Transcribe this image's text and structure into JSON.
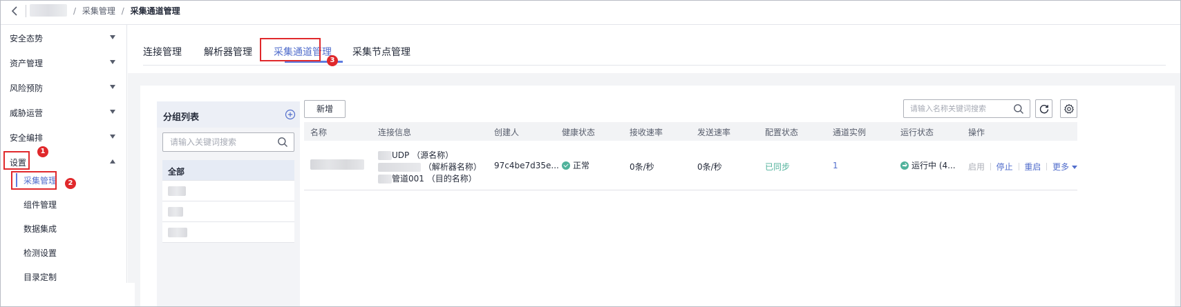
{
  "breadcrumb": {
    "items": [
      "采集管理",
      "采集通道管理"
    ],
    "separator": "/"
  },
  "sidebar": {
    "items": [
      {
        "label": "安全态势"
      },
      {
        "label": "资产管理"
      },
      {
        "label": "风险预防"
      },
      {
        "label": "威胁运营"
      },
      {
        "label": "安全编排"
      },
      {
        "label": "设置"
      }
    ],
    "sub_items": [
      {
        "label": "采集管理"
      },
      {
        "label": "组件管理"
      },
      {
        "label": "数据集成"
      },
      {
        "label": "检测设置"
      },
      {
        "label": "目录定制"
      }
    ],
    "active_sub": "采集管理"
  },
  "annotations": {
    "badge1": "1",
    "badge2": "2",
    "badge3": "3",
    "color": "#e0282b"
  },
  "tabs": [
    {
      "label": "连接管理"
    },
    {
      "label": "解析器管理"
    },
    {
      "label": "采集通道管理"
    },
    {
      "label": "采集节点管理"
    }
  ],
  "active_tab": "采集通道管理",
  "group_panel": {
    "title": "分组列表",
    "search_placeholder": "请输入关键词搜索",
    "all_label": "全部"
  },
  "toolbar": {
    "new_label": "新增",
    "search_placeholder": "请输入名称关键词搜索",
    "refresh_icon": "refresh-icon",
    "settings_icon": "gear-icon"
  },
  "table": {
    "columns": [
      "名称",
      "连接信息",
      "创建人",
      "健康状态",
      "接收速率",
      "发送速率",
      "配置状态",
      "通道实例",
      "运行状态",
      "操作"
    ],
    "rows": [
      {
        "conn_line1_text": "UDP",
        "conn_line1_note": "（源名称）",
        "conn_line2_note": "（解析器名称）",
        "conn_line3_text": "管道001",
        "conn_line3_note": "（目的名称）",
        "creator": "97c4be7d35e...",
        "health": "正常",
        "receive_rate": "0条/秒",
        "send_rate": "0条/秒",
        "config_status": "已同步",
        "instances": "1",
        "run_status": "运行中 (4...",
        "actions": {
          "enable": "启用",
          "stop": "停止",
          "restart": "重启",
          "more": "更多"
        }
      }
    ]
  },
  "colors": {
    "accent": "#526ecc",
    "success": "#50b29b",
    "highlight_box": "#e0282b"
  }
}
